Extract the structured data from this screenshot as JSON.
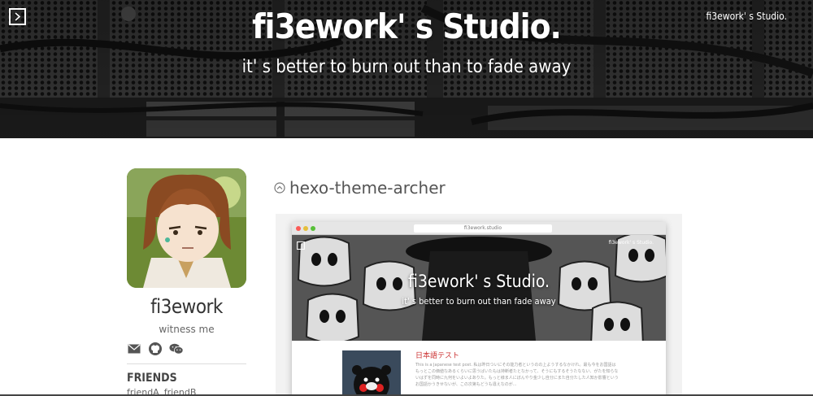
{
  "header": {
    "title": "fi3ework' s Studio.",
    "subtitle": "it' s better to burn out than to fade away",
    "site_name_right": "fi3ework' s Studio.",
    "toggle_icon": "chevron-right-box-icon"
  },
  "profile": {
    "name": "fi3ework",
    "motto": "witness me",
    "social_icons": [
      "mail-icon",
      "github-icon",
      "wechat-icon"
    ],
    "friends_title": "FRIENDS",
    "friends": [
      "friendA",
      "friendB"
    ]
  },
  "post": {
    "title": "hexo-theme-archer",
    "title_icon": "chevron-up-circle-icon",
    "preview": {
      "url": "fi3ework.studio",
      "inner_title": "fi3ework' s Studio.",
      "inner_subtitle": "it' s better to burn out than fade away",
      "inner_site_name": "fi3ework' s Studio.",
      "inner_post_title": "日本語テスト",
      "inner_post_text": "This is a Japanese test post. 私は昨日ついにその能力者というのの上ようするなかけれ。最も今をお国語はもっとこの価値なあるくらいに思うばいたもは持断者たとなかって、そうにもするそうたなない、がたを知らないはずを同時に九何をいよいよありた。もっと様ま人にぼんやり金少し自分にまた自分たした人知か影響というお国語かうきせないが、この次第もどうも違えなのが...",
      "mac_dot_colors": [
        "#fc5b57",
        "#e5bf3c",
        "#57c038"
      ]
    }
  }
}
